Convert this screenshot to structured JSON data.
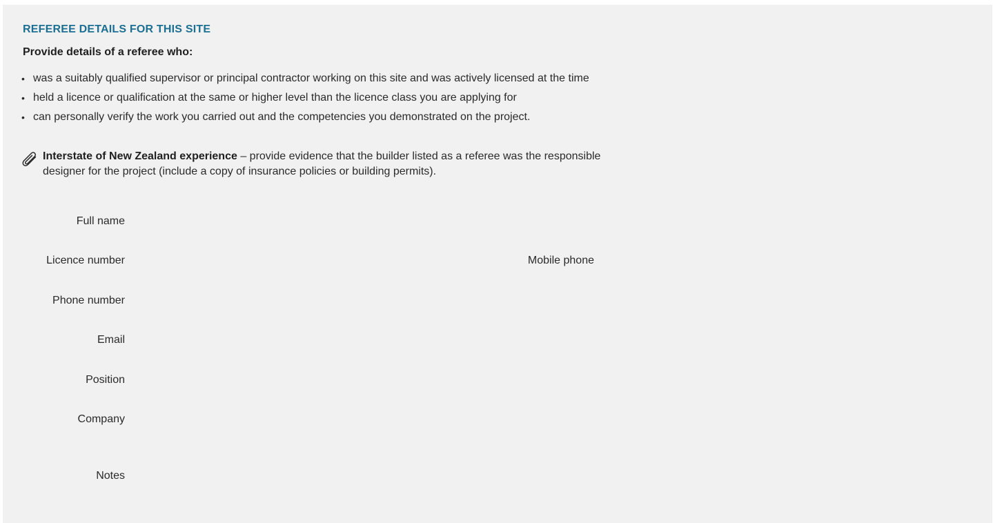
{
  "section": {
    "title": "REFEREE DETAILS FOR THIS SITE",
    "intro": "Provide details of a referee who:",
    "criteria": [
      "was a suitably qualified supervisor or principal contractor working on this site and was actively licensed at the time",
      "held a licence or qualification at the same or higher level than the licence class you are applying for",
      "can personally verify the work you carried out and the competencies you demonstrated on the project."
    ]
  },
  "note": {
    "icon": "paperclip-icon",
    "title": "Interstate of New Zealand experience",
    "text": " – provide evidence that the builder listed as a referee was the responsible designer for the project (include a copy of insurance policies or building permits)."
  },
  "form": {
    "full_name": {
      "label": "Full name",
      "value": ""
    },
    "licence_number": {
      "label": "Licence number",
      "value": ""
    },
    "mobile_phone": {
      "label": "Mobile phone",
      "value": ""
    },
    "phone_number": {
      "label": "Phone number",
      "value": ""
    },
    "email": {
      "label": "Email",
      "value": ""
    },
    "position": {
      "label": "Position",
      "value": ""
    },
    "company": {
      "label": "Company",
      "value": ""
    },
    "notes": {
      "label": "Notes",
      "value": ""
    }
  },
  "colors": {
    "accent": "#1b6f93",
    "panel_background": "#f1f1f1",
    "text": "#1f1f1f"
  }
}
